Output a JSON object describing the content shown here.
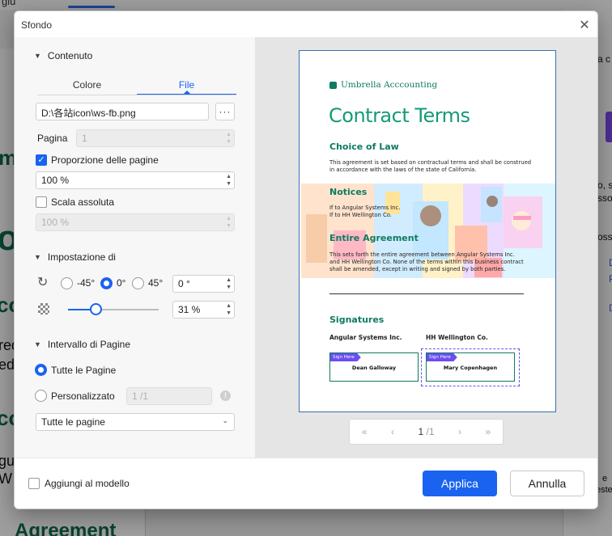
{
  "background_app": {
    "top_left_fragment": "giu",
    "right_panel": [
      "a c",
      "o, s",
      "sso",
      "oss",
      "D",
      "P",
      "D"
    ],
    "doc_left_fragments": [
      "m",
      "ol",
      "co",
      "red",
      "ed",
      "co",
      "gu",
      "W"
    ],
    "doc_bottom": "Agreement",
    "right_bottom": [
      "e",
      "este"
    ]
  },
  "dialog": {
    "title": "Sfondo",
    "close_glyph": "✕"
  },
  "content_section": {
    "header": "Contenuto",
    "tabs": [
      {
        "label": "Colore",
        "active": false
      },
      {
        "label": "File",
        "active": true
      }
    ],
    "file_path": "D:\\各站icon\\ws-fb.png",
    "browse_label": "···",
    "page_label": "Pagina",
    "page_value": "1",
    "proportion_label": "Proporzione delle pagine",
    "proportion_checked": true,
    "proportion_value": "100 %",
    "absolute_scale_label": "Scala assoluta",
    "absolute_scale_checked": false,
    "absolute_scale_value": "100 %"
  },
  "settings_section": {
    "header": "Impostazione di",
    "rotation_options": [
      {
        "label": "-45°",
        "selected": false
      },
      {
        "label": "0°",
        "selected": true
      },
      {
        "label": "45°",
        "selected": false
      }
    ],
    "rotation_value": "0 °",
    "opacity_value": "31 %",
    "opacity_level": 0.31
  },
  "page_range_section": {
    "header": "Intervallo di Pagine",
    "all_pages_label": "Tutte le Pagine",
    "all_pages_selected": true,
    "custom_label": "Personalizzato",
    "custom_placeholder": "1 /1",
    "info_glyph": "!",
    "range_select_value": "Tutte le pagine"
  },
  "preview": {
    "logo": "Umbrella Acccounting",
    "title": "Contract Terms",
    "section1_heading": "Choice of Law",
    "section1_text": "This agreement is set based on contractual terms and shall be construed in accordance with the laws of the state of California.",
    "section2_heading": "Notices",
    "section2_text": "If to Angular Systems Inc.\nIf to HH Wellington Co.",
    "section3_heading": "Entire Agreement",
    "section3_text": "This sets forth the entire agreement between Angular Systems Inc. and HH Wellington Co. None of the terms within this business contract shall be amended, except in writing and signed by both parties.",
    "signatures_heading": "Signatures",
    "party1": "Angular Systems Inc.",
    "party2": "HH Wellington Co.",
    "sign_tag": "Sign Here",
    "signer1": "Dean Galloway",
    "signer2": "Mary Copenhagen"
  },
  "pager": {
    "first": "«",
    "prev": "‹",
    "current": "1",
    "total": "/1",
    "next": "›",
    "last": "»"
  },
  "footer": {
    "add_to_template_label": "Aggiungi al modello",
    "add_to_template_checked": false,
    "apply_label": "Applica",
    "cancel_label": "Annulla"
  },
  "colors": {
    "accent": "#1a63f0",
    "brand_green": "#159a78",
    "sign_tag": "#6b4ef0"
  }
}
